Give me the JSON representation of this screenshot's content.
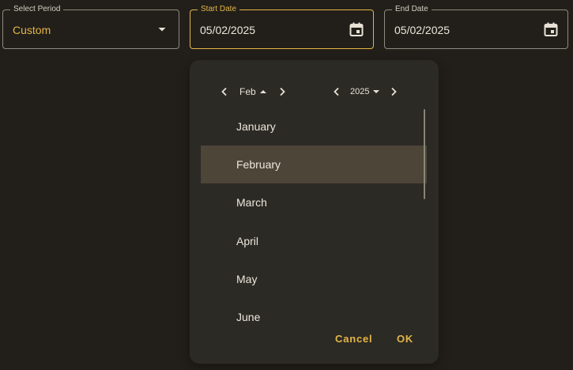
{
  "fields": {
    "period": {
      "label": "Select Period",
      "value": "Custom"
    },
    "start": {
      "label": "Start Date",
      "value": "05/02/2025"
    },
    "end": {
      "label": "End Date",
      "value": "05/02/2025"
    }
  },
  "picker": {
    "month_label": "Feb",
    "year_label": "2025",
    "months": [
      "January",
      "February",
      "March",
      "April",
      "May",
      "June"
    ],
    "selected_month": "February",
    "cancel_label": "Cancel",
    "ok_label": "OK"
  },
  "colors": {
    "accent": "#e3b547",
    "background": "#221f1a",
    "surface": "#2c2a25",
    "selected": "#4c4538"
  },
  "icons": {
    "period_dropdown": "arrow-drop-down-icon",
    "calendar": "calendar-icon"
  }
}
